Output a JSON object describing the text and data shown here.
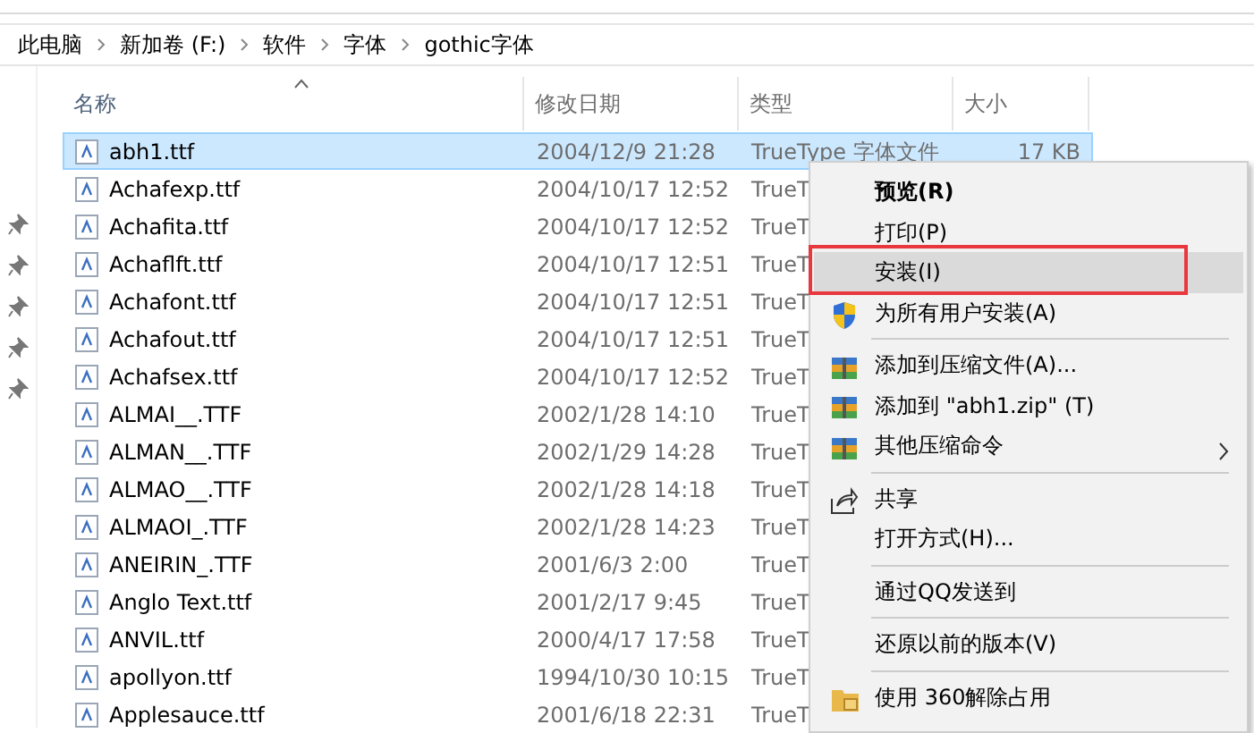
{
  "breadcrumb": [
    "此电脑",
    "新加卷 (F:)",
    "软件",
    "字体",
    "gothic字体"
  ],
  "columns": [
    {
      "label": "名称",
      "sorted": true
    },
    {
      "label": "修改日期",
      "sorted": false
    },
    {
      "label": "类型",
      "sorted": false
    },
    {
      "label": "大小",
      "sorted": false
    }
  ],
  "files": [
    {
      "name": "abh1.ttf",
      "modified": "2004/12/9 21:28",
      "type": "TrueType 字体文件",
      "size": "17 KB",
      "selected": true
    },
    {
      "name": "Achafexp.ttf",
      "modified": "2004/10/17 12:52",
      "type": "TrueT",
      "selected": false
    },
    {
      "name": "Achafita.ttf",
      "modified": "2004/10/17 12:52",
      "type": "TrueT",
      "selected": false
    },
    {
      "name": "Achaflft.ttf",
      "modified": "2004/10/17 12:51",
      "type": "TrueT",
      "selected": false
    },
    {
      "name": "Achafont.ttf",
      "modified": "2004/10/17 12:51",
      "type": "TrueT",
      "selected": false
    },
    {
      "name": "Achafout.ttf",
      "modified": "2004/10/17 12:51",
      "type": "TrueT",
      "selected": false
    },
    {
      "name": "Achafsex.ttf",
      "modified": "2004/10/17 12:52",
      "type": "TrueT",
      "selected": false
    },
    {
      "name": "ALMAI__.TTF",
      "modified": "2002/1/28 14:10",
      "type": "TrueT",
      "selected": false
    },
    {
      "name": "ALMAN__.TTF",
      "modified": "2002/1/29 14:28",
      "type": "TrueT",
      "selected": false
    },
    {
      "name": "ALMAO__.TTF",
      "modified": "2002/1/28 14:18",
      "type": "TrueT",
      "selected": false
    },
    {
      "name": "ALMAOI_.TTF",
      "modified": "2002/1/28 14:23",
      "type": "TrueT",
      "selected": false
    },
    {
      "name": "ANEIRIN_.TTF",
      "modified": "2001/6/3 2:00",
      "type": "TrueT",
      "selected": false
    },
    {
      "name": "Anglo Text.ttf",
      "modified": "2001/2/17 9:45",
      "type": "TrueT",
      "selected": false
    },
    {
      "name": "ANVIL.ttf",
      "modified": "2000/4/17 17:58",
      "type": "TrueT",
      "selected": false
    },
    {
      "name": "apollyon.ttf",
      "modified": "1994/10/30 10:15",
      "type": "TrueT",
      "selected": false
    },
    {
      "name": "Applesauce.ttf",
      "modified": "2001/6/18 22:31",
      "type": "TrueT",
      "selected": false
    }
  ],
  "context_menu": [
    {
      "kind": "plain",
      "label": "预览(R)",
      "default": true,
      "highlighted": false,
      "annotated": false,
      "submenu": false
    },
    {
      "kind": "plain",
      "label": "打印(P)",
      "default": false,
      "highlighted": false,
      "annotated": false,
      "submenu": false
    },
    {
      "kind": "plain",
      "label": "安装(I)",
      "default": false,
      "highlighted": true,
      "annotated": true,
      "submenu": false
    },
    {
      "kind": "shield",
      "label": "为所有用户安装(A)",
      "default": false,
      "highlighted": false,
      "annotated": false,
      "submenu": false
    },
    {
      "kind": "separator"
    },
    {
      "kind": "archive",
      "label": "添加到压缩文件(A)...",
      "default": false,
      "highlighted": false,
      "annotated": false,
      "submenu": false
    },
    {
      "kind": "archive",
      "label": "添加到 \"abh1.zip\" (T)",
      "default": false,
      "highlighted": false,
      "annotated": false,
      "submenu": false
    },
    {
      "kind": "archive",
      "label": "其他压缩命令",
      "default": false,
      "highlighted": false,
      "annotated": false,
      "submenu": true
    },
    {
      "kind": "separator"
    },
    {
      "kind": "share",
      "label": "共享",
      "default": false,
      "highlighted": false,
      "annotated": false,
      "submenu": false
    },
    {
      "kind": "plain",
      "label": "打开方式(H)...",
      "default": false,
      "highlighted": false,
      "annotated": false,
      "submenu": false
    },
    {
      "kind": "separator"
    },
    {
      "kind": "plain",
      "label": "通过QQ发送到",
      "default": false,
      "highlighted": false,
      "annotated": false,
      "submenu": false
    },
    {
      "kind": "separator"
    },
    {
      "kind": "plain",
      "label": "还原以前的版本(V)",
      "default": false,
      "highlighted": false,
      "annotated": false,
      "submenu": false
    },
    {
      "kind": "separator"
    },
    {
      "kind": "unlock",
      "label": "使用 360解除占用",
      "default": false,
      "highlighted": false,
      "annotated": false,
      "submenu": false
    }
  ]
}
